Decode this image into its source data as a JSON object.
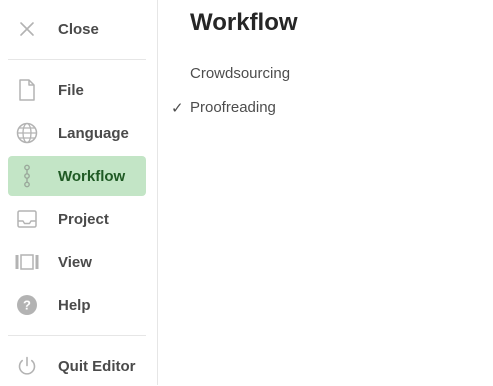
{
  "sidebar": {
    "close_label": "Close",
    "items": [
      {
        "label": "File",
        "icon": "file-icon"
      },
      {
        "label": "Language",
        "icon": "globe-icon"
      },
      {
        "label": "Workflow",
        "icon": "workflow-icon",
        "active": true
      },
      {
        "label": "Project",
        "icon": "inbox-icon"
      },
      {
        "label": "View",
        "icon": "view-icon"
      },
      {
        "label": "Help",
        "icon": "help-icon"
      }
    ],
    "quit_label": "Quit Editor"
  },
  "main": {
    "title": "Workflow",
    "options": [
      {
        "label": "Crowdsourcing",
        "checked": false
      },
      {
        "label": "Proofreading",
        "checked": true
      }
    ],
    "check_glyph": "✓"
  },
  "colors": {
    "active_bg": "#c3e5c6",
    "active_text": "#1f5a24",
    "icon_gray": "#b3b3b3"
  }
}
